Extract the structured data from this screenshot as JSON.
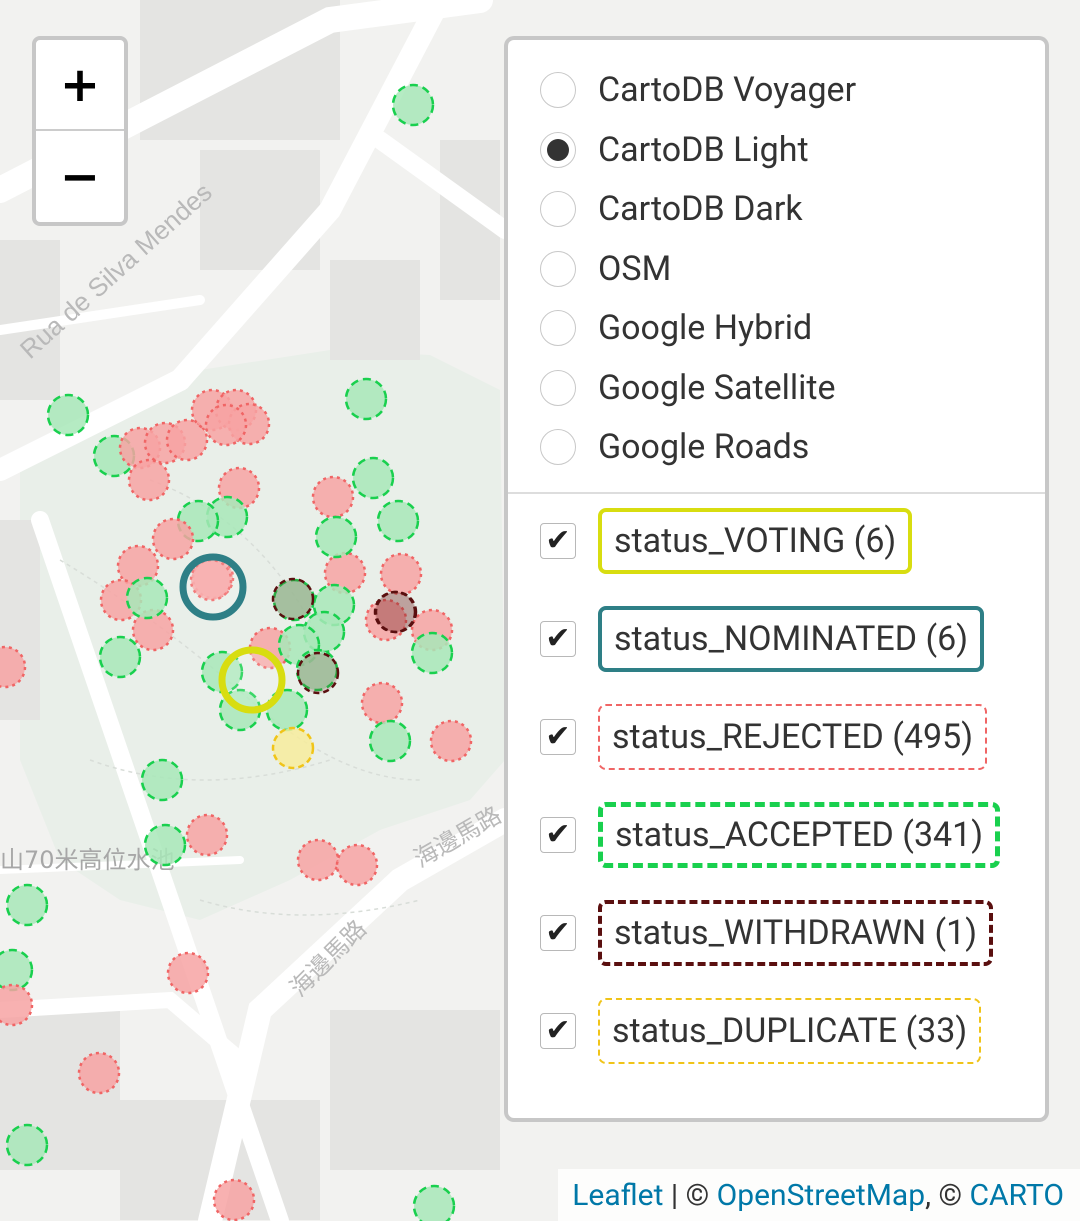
{
  "zoom": {
    "in_label": "+",
    "out_label": "−"
  },
  "base_layers": [
    {
      "label": "CartoDB Voyager",
      "checked": false
    },
    {
      "label": "CartoDB Light",
      "checked": true
    },
    {
      "label": "CartoDB Dark",
      "checked": false
    },
    {
      "label": "OSM",
      "checked": false
    },
    {
      "label": "Google Hybrid",
      "checked": false
    },
    {
      "label": "Google Satellite",
      "checked": false
    },
    {
      "label": "Google Roads",
      "checked": false
    }
  ],
  "overlays": [
    {
      "label": "status_VOTING (6)",
      "checked": true,
      "color": "#d8dd10",
      "style": "solid"
    },
    {
      "label": "status_NOMINATED (6)",
      "checked": true,
      "color": "#2e7f86",
      "style": "solid"
    },
    {
      "label": "status_REJECTED (495)",
      "checked": true,
      "color": "#f06565",
      "style": "dotted"
    },
    {
      "label": "status_ACCEPTED (341)",
      "checked": true,
      "color": "#19d04e",
      "style": "dashed"
    },
    {
      "label": "status_WITHDRAWN (1)",
      "checked": true,
      "color": "#5a0f0f",
      "style": "dashed"
    },
    {
      "label": "status_DUPLICATE (33)",
      "checked": true,
      "color": "#f0c419",
      "style": "dashed"
    }
  ],
  "map_labels": {
    "street_1": "Rua de Silva Mendes",
    "street_2": "山70米高位水池",
    "street_3": "海邊馬路",
    "street_4": "海邊馬路"
  },
  "attribution": {
    "leaflet": "Leaflet",
    "sep1": " | © ",
    "osm": "OpenStreetMap",
    "sep2": ", © ",
    "carto": "CARTO"
  },
  "colors": {
    "rejected_fill": "#f7a3a3",
    "accepted_fill": "#a8e8b8",
    "duplicate_fill": "#f7ec9c"
  }
}
